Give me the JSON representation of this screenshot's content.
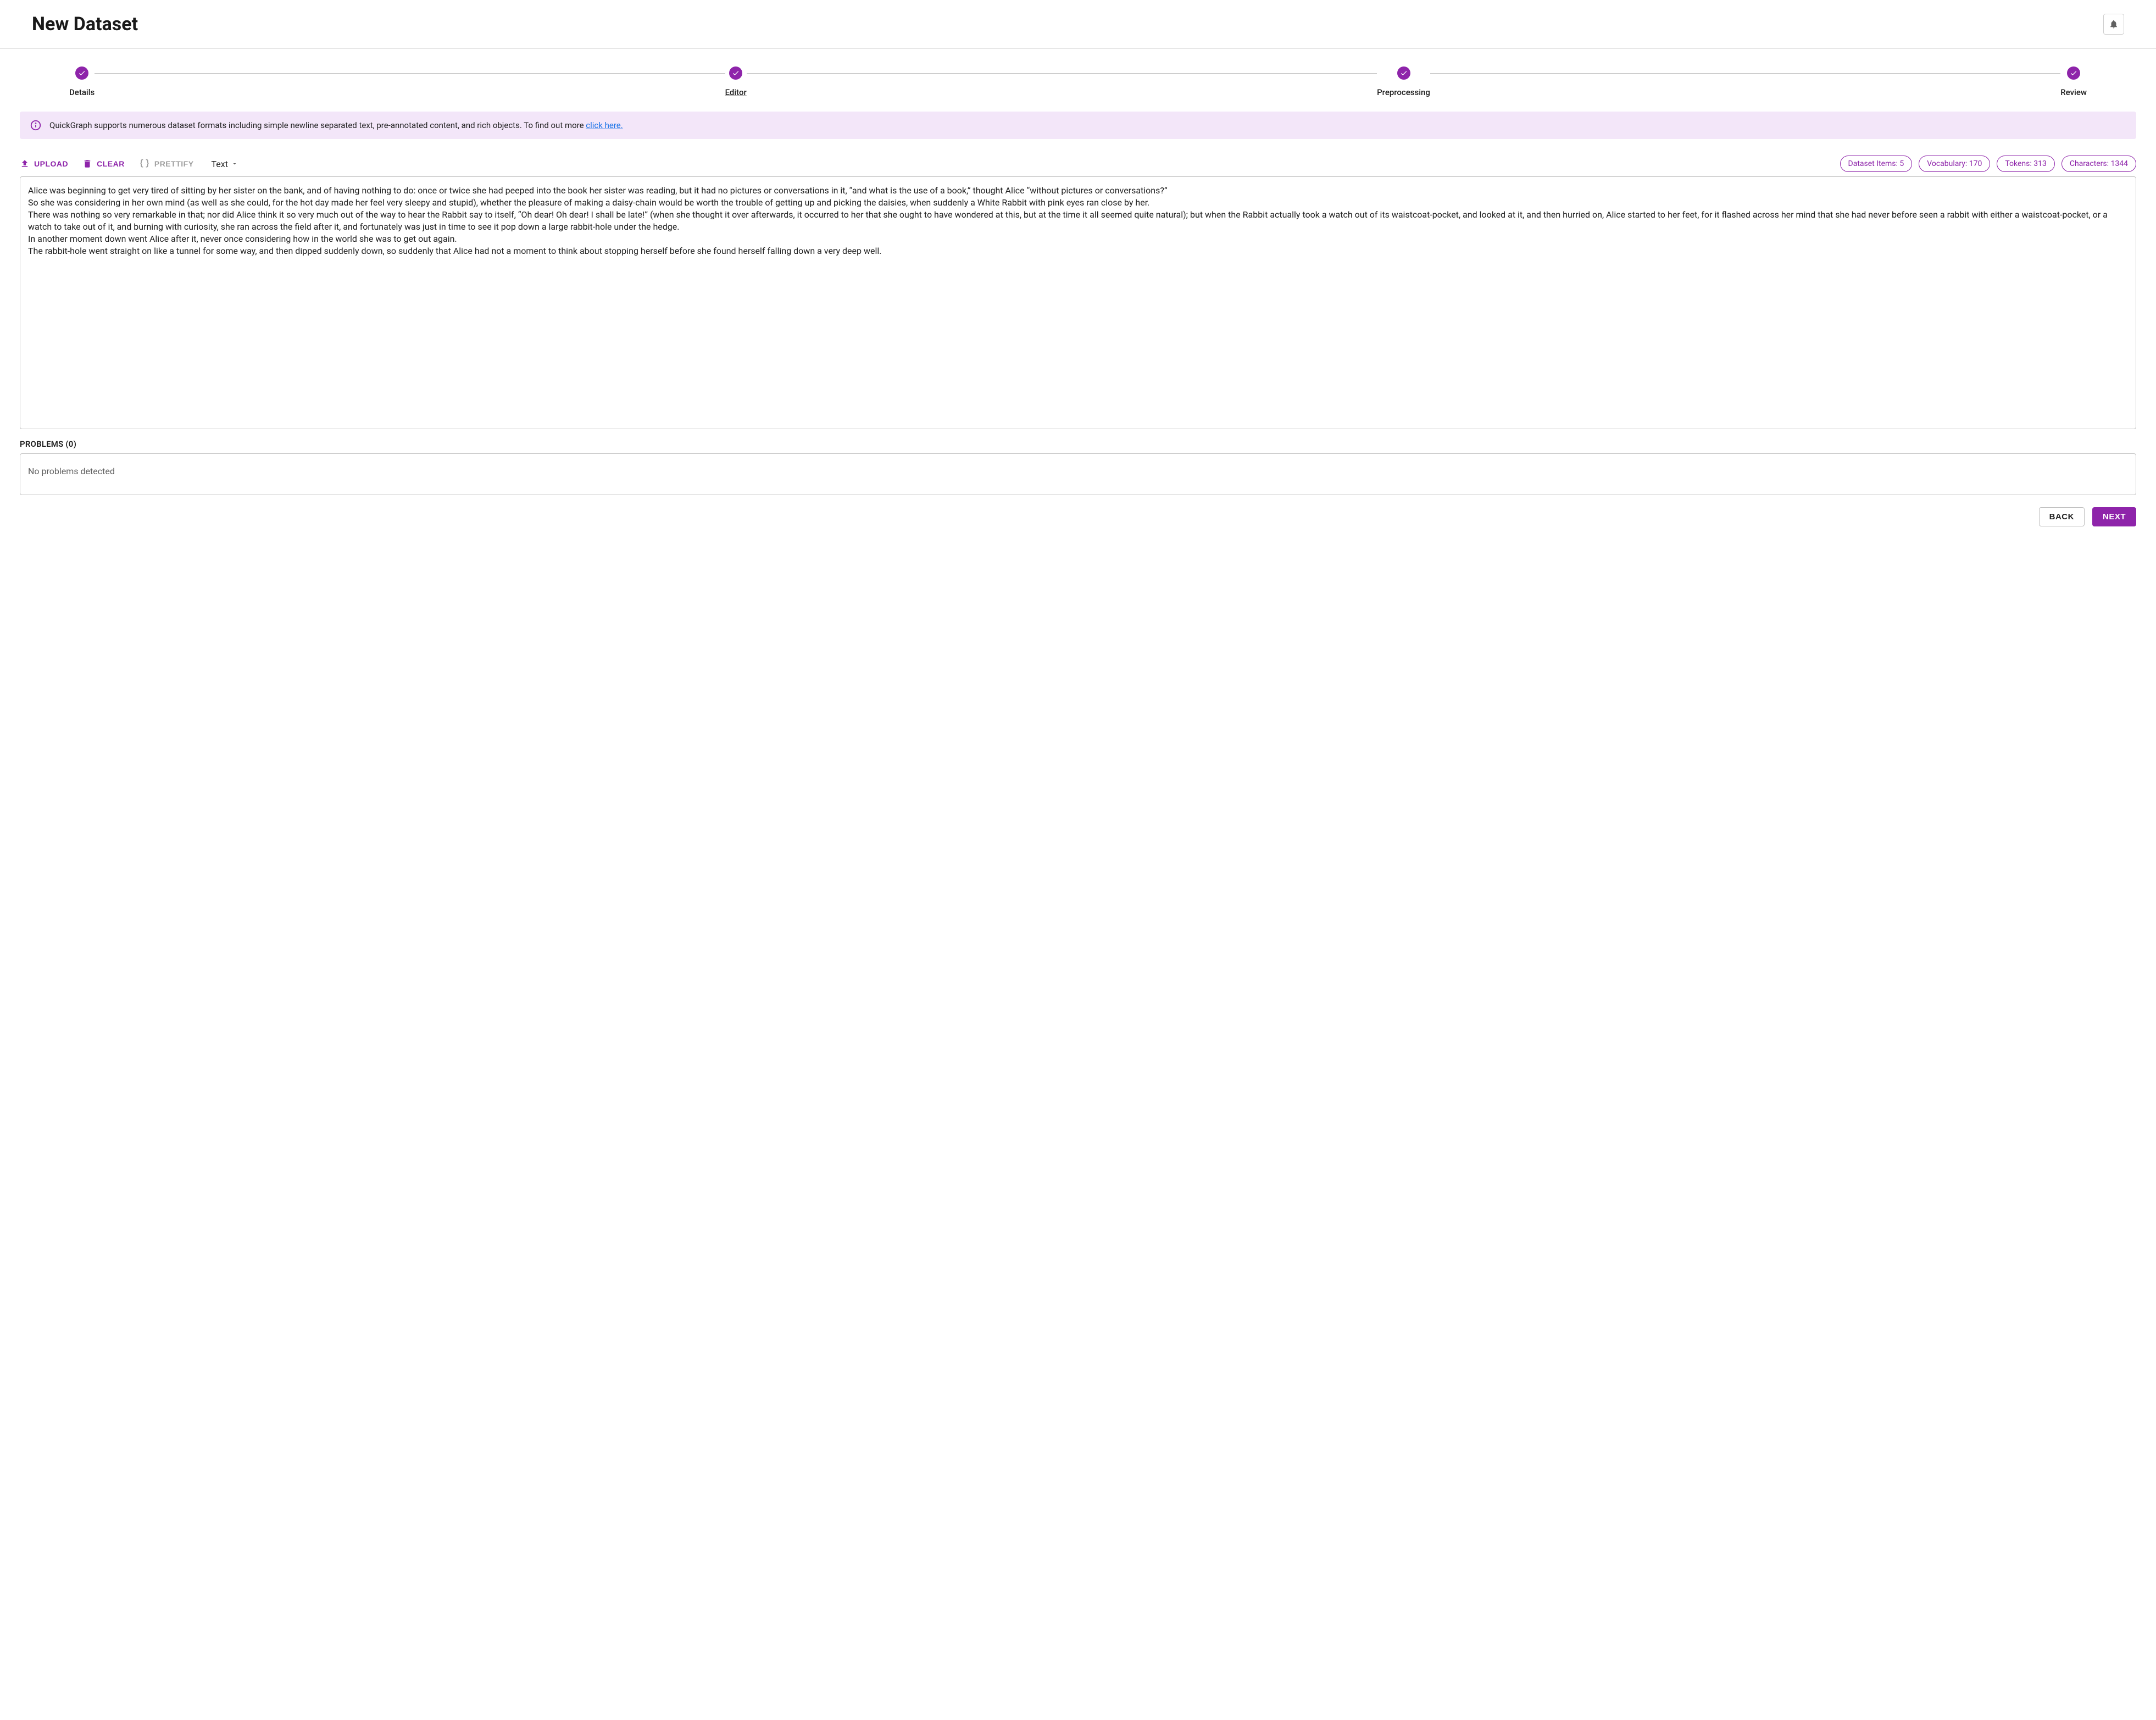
{
  "header": {
    "title": "New Dataset"
  },
  "stepper": {
    "steps": [
      {
        "label": "Details",
        "active": false
      },
      {
        "label": "Editor",
        "active": true
      },
      {
        "label": "Preprocessing",
        "active": false
      },
      {
        "label": "Review",
        "active": false
      }
    ]
  },
  "banner": {
    "text": "QuickGraph supports numerous dataset formats including simple newline separated text, pre-annotated content, and rich objects. To find out more ",
    "link_text": "click here."
  },
  "toolbar": {
    "upload": "UPLOAD",
    "clear": "CLEAR",
    "prettify": "PRETTIFY",
    "format_label": "Text"
  },
  "stats": {
    "items": "Dataset Items: 5",
    "vocabulary": "Vocabulary: 170",
    "tokens": "Tokens: 313",
    "characters": "Characters: 1344"
  },
  "editor": {
    "value": "Alice was beginning to get very tired of sitting by her sister on the bank, and of having nothing to do: once or twice she had peeped into the book her sister was reading, but it had no pictures or conversations in it, “and what is the use of a book,” thought Alice “without pictures or conversations?”\nSo she was considering in her own mind (as well as she could, for the hot day made her feel very sleepy and stupid), whether the pleasure of making a daisy-chain would be worth the trouble of getting up and picking the daisies, when suddenly a White Rabbit with pink eyes ran close by her.\nThere was nothing so very remarkable in that; nor did Alice think it so very much out of the way to hear the Rabbit say to itself, “Oh dear! Oh dear! I shall be late!” (when she thought it over afterwards, it occurred to her that she ought to have wondered at this, but at the time it all seemed quite natural); but when the Rabbit actually took a watch out of its waistcoat-pocket, and looked at it, and then hurried on, Alice started to her feet, for it flashed across her mind that she had never before seen a rabbit with either a waistcoat-pocket, or a watch to take out of it, and burning with curiosity, she ran across the field after it, and fortunately was just in time to see it pop down a large rabbit-hole under the hedge.\nIn another moment down went Alice after it, never once considering how in the world she was to get out again.\nThe rabbit-hole went straight on like a tunnel for some way, and then dipped suddenly down, so suddenly that Alice had not a moment to think about stopping herself before she found herself falling down a very deep well."
  },
  "problems": {
    "label": "PROBLEMS (0)",
    "empty_message": "No problems detected"
  },
  "footer": {
    "back": "BACK",
    "next": "NEXT"
  }
}
